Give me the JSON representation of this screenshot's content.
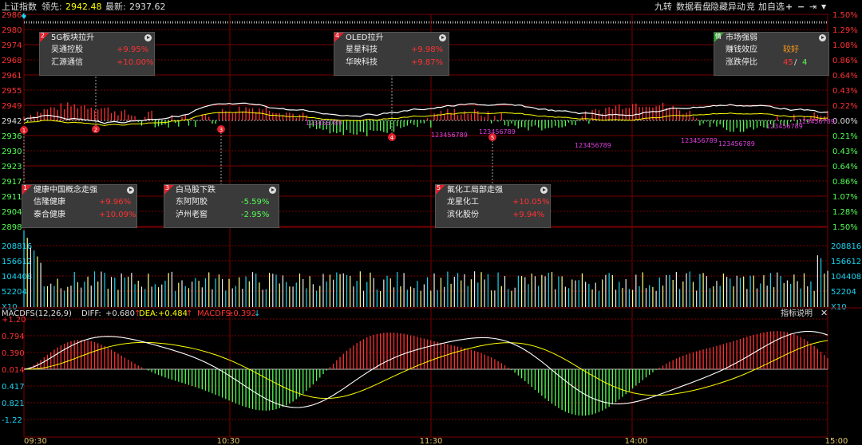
{
  "header": {
    "title": "上证指数",
    "leader_label": "领先:",
    "leader_value": "2942.48",
    "latest_label": "最新:",
    "latest_value": "2937.62",
    "buttons": [
      "九转",
      "数据看盘",
      "隐藏异动",
      "竞",
      "加自选"
    ],
    "icons": [
      "plus-icon",
      "minus-icon",
      "arrow-right-icon"
    ]
  },
  "price_axis": {
    "left": [
      "2986",
      "2980",
      "2974",
      "2968",
      "2961",
      "2955",
      "2949",
      "2942",
      "2936",
      "2930",
      "2923",
      "2917",
      "2911",
      "2904",
      "2898"
    ],
    "right": [
      "1.50%",
      "1.29%",
      "1.08%",
      "0.86%",
      "0.64%",
      "0.43%",
      "0.22%",
      "0.00%",
      "0.21%",
      "0.43%",
      "0.64%",
      "0.86%",
      "1.07%",
      "1.28%",
      "1.50%"
    ]
  },
  "volume_axis": {
    "left": [
      "208816",
      "156612",
      "104408",
      "52204",
      "X10"
    ],
    "right": [
      "208816",
      "156612",
      "104408",
      "52204",
      "X10"
    ]
  },
  "macd": {
    "title": "MACDFS(12,26,9)",
    "diff_label": "DIFF:",
    "diff_value": "+0.680",
    "dea_label": "DEA:",
    "dea_value": "+0.484",
    "macd_label": "MACDFS:",
    "macd_value": "+0.392",
    "help_label": "指标说明",
    "axis": [
      "+1.20",
      "0.794",
      "0.390",
      "0.014",
      "0.417",
      "0.821",
      "-1.22"
    ]
  },
  "time_axis": [
    "09:30",
    "10:30",
    "11:30",
    "14:00",
    "15:00"
  ],
  "events": [
    {
      "num": "2",
      "title": "5G板块拉升",
      "rows": [
        {
          "name": "吴通控股",
          "value": "+9.95%"
        },
        {
          "name": "汇源通信",
          "value": "+10.00%"
        }
      ]
    },
    {
      "num": "4",
      "title": "OLED拉升",
      "rows": [
        {
          "name": "星星科技",
          "value": "+9.98%"
        },
        {
          "name": "华映科技",
          "value": "+9.87%"
        }
      ]
    },
    {
      "num": "1",
      "title": "健康中国概念走强",
      "rows": [
        {
          "name": "信隆健康",
          "value": "+9.96%"
        },
        {
          "name": "泰合健康",
          "value": "+10.09%"
        }
      ]
    },
    {
      "num": "3",
      "title": "白马股下跌",
      "rows": [
        {
          "name": "东阿阿胶",
          "value": "-5.59%"
        },
        {
          "name": "泸州老窖",
          "value": "-2.95%"
        }
      ]
    },
    {
      "num": "5",
      "title": "氟化工局部走强",
      "rows": [
        {
          "name": "龙星化工",
          "value": "+10.05%"
        },
        {
          "name": "滨化股份",
          "value": "+9.94%"
        }
      ]
    }
  ],
  "market": {
    "badge": "情",
    "title": "市场强弱",
    "effect_label": "赚钱效应",
    "effect_value": "较好",
    "ratio_label": "涨跌停比",
    "up_count": "45",
    "sep": "/",
    "down_count": "4"
  },
  "markers": {
    "sequences": [
      "123456789",
      "123456789",
      "123456789",
      "123456789",
      "123456789",
      "123456789",
      "123456789",
      "123456789"
    ],
    "event_nums": [
      "1",
      "2",
      "3",
      "4",
      "5"
    ]
  },
  "colors": {
    "background": "#000000",
    "grid": "#7a0000",
    "up": "#ff3232",
    "down": "#54ff54",
    "price_line": "#ffffff",
    "avg_line": "#ffff00",
    "axis_text_left": "#ff3232",
    "axis_text_right": "#ff3232",
    "volume_text": "#19d4f0",
    "magenta": "#e040e0"
  }
}
